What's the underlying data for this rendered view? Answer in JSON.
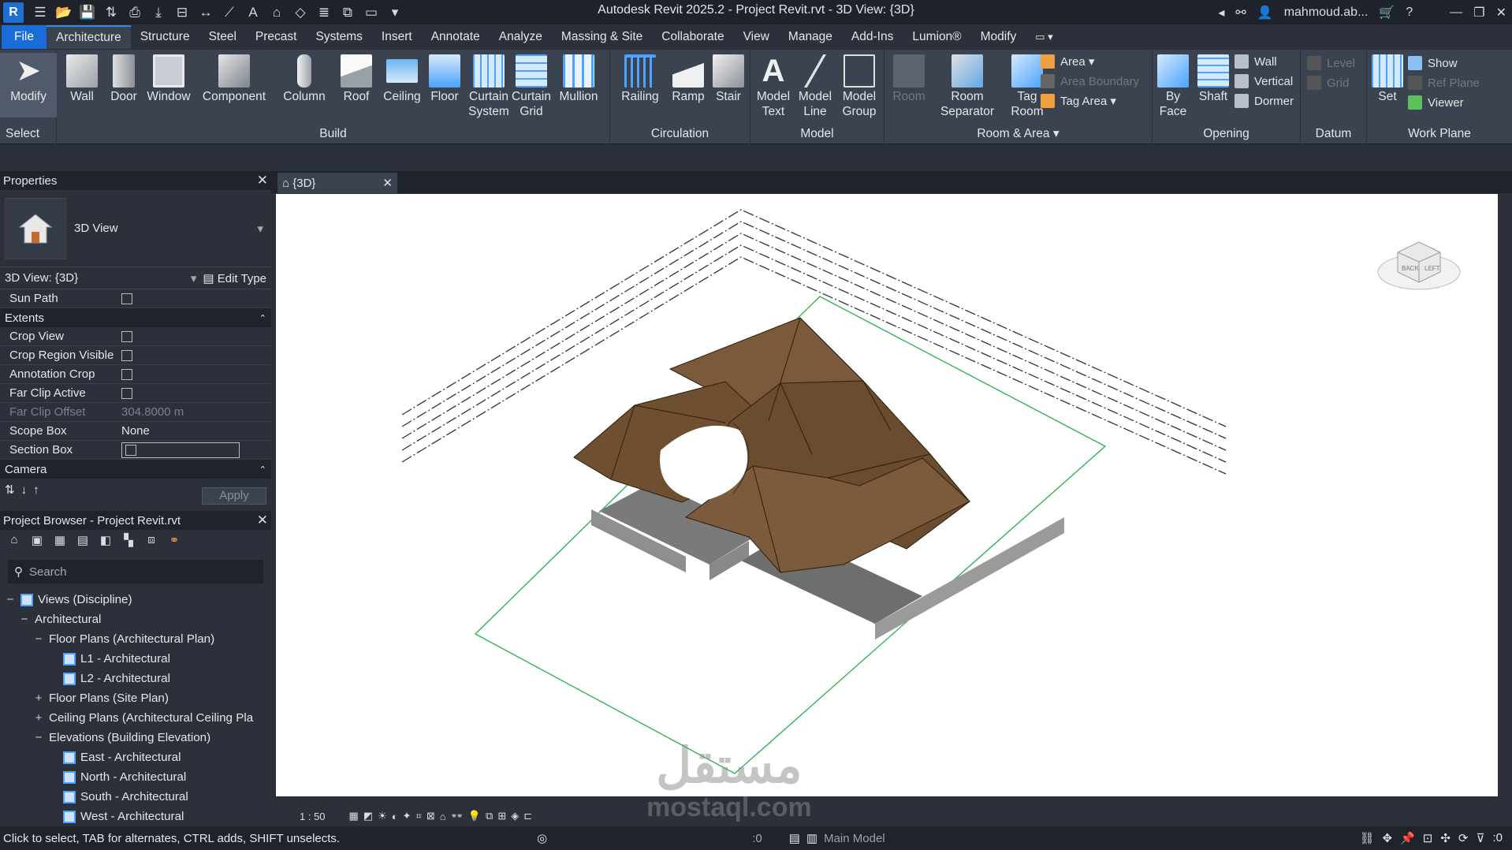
{
  "app": {
    "title": "Autodesk Revit 2025.2 - Project Revit.rvt - 3D View: {3D}",
    "user": "mahmoud.ab..."
  },
  "menu": {
    "tabs": [
      "File",
      "Architecture",
      "Structure",
      "Steel",
      "Precast",
      "Systems",
      "Insert",
      "Annotate",
      "Analyze",
      "Massing & Site",
      "Collaborate",
      "View",
      "Manage",
      "Add-Ins",
      "Lumion®",
      "Modify"
    ],
    "active": "Architecture"
  },
  "ribbon": {
    "select": {
      "modify": "Modify",
      "title": "Select"
    },
    "build": {
      "wall": "Wall",
      "door": "Door",
      "window": "Window",
      "component": "Component",
      "column": "Column",
      "roof": "Roof",
      "ceiling": "Ceiling",
      "floor": "Floor",
      "curtain_system_1": "Curtain",
      "curtain_system_2": "System",
      "curtain_grid_1": "Curtain",
      "curtain_grid_2": "Grid",
      "mullion": "Mullion",
      "title": "Build"
    },
    "circulation": {
      "railing": "Railing",
      "ramp": "Ramp",
      "stair": "Stair",
      "title": "Circulation"
    },
    "model": {
      "model_text_1": "Model",
      "model_text_2": "Text",
      "model_line_1": "Model",
      "model_line_2": "Line",
      "model_group_1": "Model",
      "model_group_2": "Group",
      "title": "Model"
    },
    "room_area": {
      "room": "Room",
      "room_sep_1": "Room",
      "room_sep_2": "Separator",
      "tag_room_1": "Tag",
      "tag_room_2": "Room",
      "area": "Area",
      "area_boundary": "Area Boundary",
      "tag_area": "Tag  Area",
      "title": "Room & Area"
    },
    "opening": {
      "by_face_1": "By",
      "by_face_2": "Face",
      "shaft": "Shaft",
      "wall": "Wall",
      "vertical": "Vertical",
      "dormer": "Dormer",
      "title": "Opening"
    },
    "datum": {
      "level": "Level",
      "grid": "Grid",
      "title": "Datum"
    },
    "work_plane": {
      "set": "Set",
      "show": "Show",
      "ref_plane": "Ref  Plane",
      "viewer": "Viewer",
      "title": "Work Plane"
    }
  },
  "properties": {
    "header": "Properties",
    "type_name": "3D View",
    "view_selector": "3D View: {3D}",
    "edit_type": "Edit Type",
    "rows_top": [
      {
        "k": "Sun Path"
      }
    ],
    "section_extents": "Extents",
    "extents_rows": [
      {
        "k": "Crop View",
        "v": ""
      },
      {
        "k": "Crop Region Visible",
        "v": ""
      },
      {
        "k": "Annotation Crop",
        "v": ""
      },
      {
        "k": "Far Clip Active",
        "v": ""
      },
      {
        "k": "Far Clip Offset",
        "v": "304.8000 m"
      },
      {
        "k": "Scope Box",
        "v": "None"
      },
      {
        "k": "Section Box",
        "v": ""
      }
    ],
    "section_camera": "Camera",
    "apply": "Apply"
  },
  "browser": {
    "header": "Project Browser - Project Revit.rvt",
    "search_placeholder": "Search",
    "tree": [
      {
        "t": "−",
        "label": "Views (Discipline)",
        "lvl": 0
      },
      {
        "t": "−",
        "label": "Architectural",
        "lvl": 1
      },
      {
        "t": "−",
        "label": "Floor Plans (Architectural Plan)",
        "lvl": 2
      },
      {
        "t": "",
        "label": "L1 - Architectural",
        "lvl": 3,
        "view": true
      },
      {
        "t": "",
        "label": "L2 - Architectural",
        "lvl": 3,
        "view": true
      },
      {
        "t": "+",
        "label": "Floor Plans (Site Plan)",
        "lvl": 2
      },
      {
        "t": "+",
        "label": "Ceiling Plans (Architectural Ceiling Pla",
        "lvl": 2
      },
      {
        "t": "−",
        "label": "Elevations (Building Elevation)",
        "lvl": 2
      },
      {
        "t": "",
        "label": "East - Architectural",
        "lvl": 3,
        "view": true
      },
      {
        "t": "",
        "label": "North - Architectural",
        "lvl": 3,
        "view": true
      },
      {
        "t": "",
        "label": "South - Architectural",
        "lvl": 3,
        "view": true
      },
      {
        "t": "",
        "label": "West - Architectural",
        "lvl": 3,
        "view": true
      }
    ]
  },
  "view": {
    "tab": "{3D}",
    "scale": "1 : 50",
    "cube_back": "BACK",
    "cube_left": "LEFT"
  },
  "status": {
    "text": "Click to select, TAB for alternates, CTRL adds, SHIFT unselects.",
    "model": "Main Model",
    "sel_count": ":0",
    "filter_count": ":0"
  },
  "watermark": {
    "arabic": "مستقل",
    "url": "mostaql.com"
  }
}
